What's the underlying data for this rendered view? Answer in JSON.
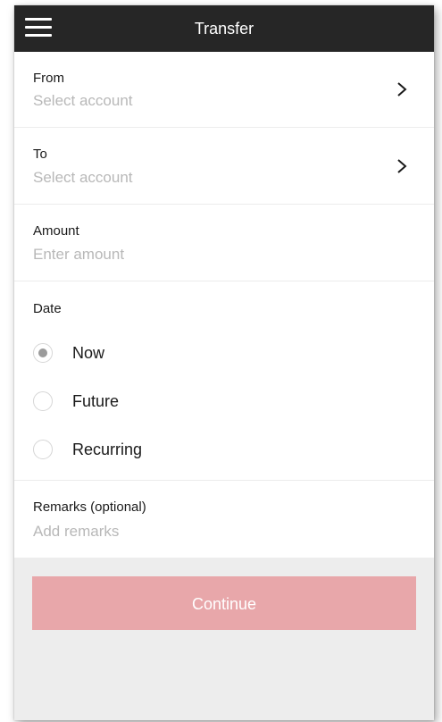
{
  "header": {
    "title": "Transfer",
    "menu_icon": "hamburger-menu-icon"
  },
  "fields": {
    "from": {
      "label": "From",
      "placeholder": "Select account",
      "icon": "chevron-right-icon"
    },
    "to": {
      "label": "To",
      "placeholder": "Select account",
      "icon": "chevron-right-icon"
    },
    "amount": {
      "label": "Amount",
      "placeholder": "Enter amount"
    },
    "remarks": {
      "label": "Remarks (optional)",
      "placeholder": "Add remarks"
    }
  },
  "date": {
    "label": "Date",
    "options": [
      {
        "label": "Now",
        "selected": true
      },
      {
        "label": "Future",
        "selected": false
      },
      {
        "label": "Recurring",
        "selected": false
      }
    ]
  },
  "actions": {
    "continue_label": "Continue"
  },
  "colors": {
    "header_bg": "#262626",
    "button_bg": "#e8a7aa",
    "footer_bg": "#ededed",
    "placeholder": "#b8b8b8"
  }
}
